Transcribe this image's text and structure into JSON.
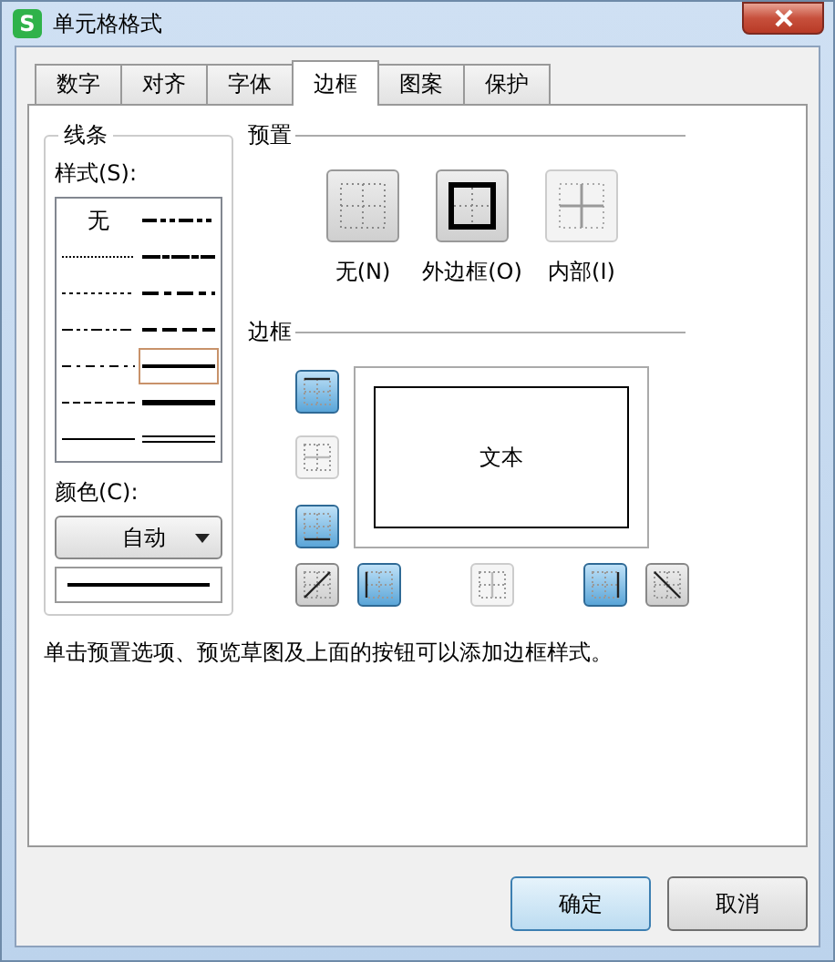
{
  "window": {
    "title": "单元格格式",
    "icon_text": "S"
  },
  "tabs": [
    {
      "label": "数字",
      "selected": false
    },
    {
      "label": "对齐",
      "selected": false
    },
    {
      "label": "字体",
      "selected": false
    },
    {
      "label": "边框",
      "selected": true
    },
    {
      "label": "图案",
      "selected": false
    },
    {
      "label": "保护",
      "selected": false
    }
  ],
  "line_group": {
    "title": "线条",
    "style_label": "样式(S):",
    "styles": [
      {
        "kind": "none",
        "label": "无",
        "selected": false
      },
      {
        "kind": "medium-dash-dot-dot",
        "selected": false
      },
      {
        "kind": "hair",
        "selected": false
      },
      {
        "kind": "slanted-dash-dot",
        "selected": false
      },
      {
        "kind": "dotted",
        "selected": false
      },
      {
        "kind": "medium-dash-dot",
        "selected": false
      },
      {
        "kind": "dash-dot-dot",
        "selected": false
      },
      {
        "kind": "medium-dashed",
        "selected": false
      },
      {
        "kind": "dash-dot",
        "selected": false
      },
      {
        "kind": "medium",
        "selected": true
      },
      {
        "kind": "dashed",
        "selected": false
      },
      {
        "kind": "thick",
        "selected": false
      },
      {
        "kind": "thin",
        "selected": false
      },
      {
        "kind": "double",
        "selected": false
      }
    ],
    "color_label": "颜色(C):",
    "color_value": "自动"
  },
  "presets": {
    "title": "预置",
    "items": [
      {
        "kind": "none",
        "label": "无(N)",
        "disabled": false
      },
      {
        "kind": "outline",
        "label": "外边框(O)",
        "disabled": false
      },
      {
        "kind": "inside",
        "label": "内部(I)",
        "disabled": true
      }
    ]
  },
  "borders": {
    "title": "边框",
    "preview_text": "文本",
    "buttons": [
      {
        "kind": "top",
        "on": true,
        "disabled": false
      },
      {
        "kind": "middle-h",
        "on": false,
        "disabled": true
      },
      {
        "kind": "bottom",
        "on": true,
        "disabled": false
      },
      {
        "kind": "diag-up",
        "on": false,
        "disabled": false
      },
      {
        "kind": "left",
        "on": true,
        "disabled": false
      },
      {
        "kind": "middle-v",
        "on": false,
        "disabled": true
      },
      {
        "kind": "right",
        "on": true,
        "disabled": false
      },
      {
        "kind": "diag-down",
        "on": false,
        "disabled": false
      }
    ]
  },
  "hint": "单击预置选项、预览草图及上面的按钮可以添加边框样式。",
  "buttons": [
    {
      "label": "确定",
      "default": true
    },
    {
      "label": "取消",
      "default": false
    }
  ]
}
